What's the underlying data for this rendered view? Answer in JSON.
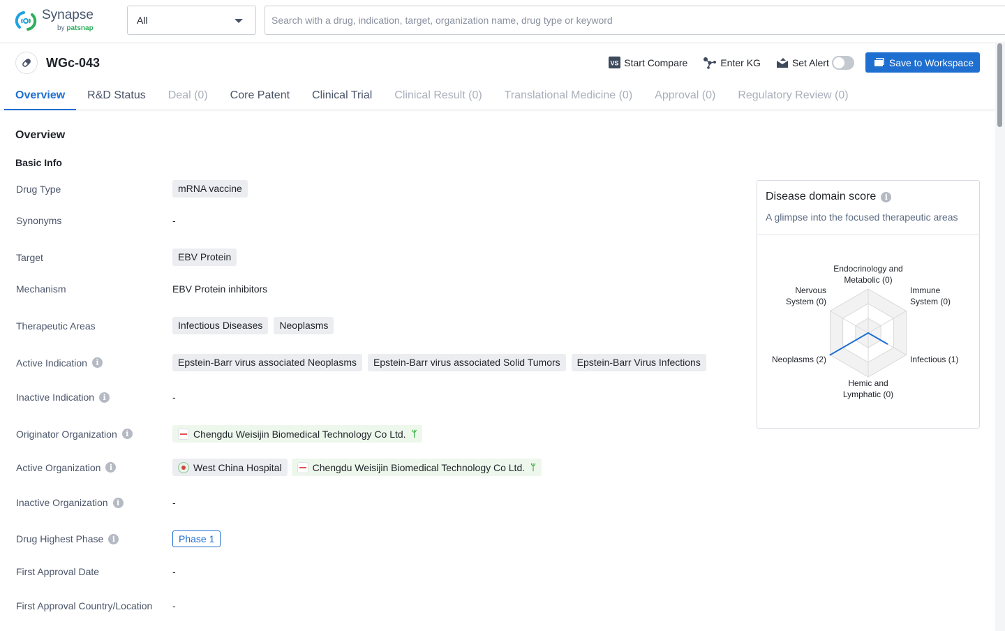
{
  "app": {
    "logo_name": "Synapse",
    "logo_by": "by",
    "logo_brand": "patsnap"
  },
  "search": {
    "scope_selected": "All",
    "placeholder": "Search with a drug, indication, target, organization name, drug type or keyword",
    "value": ""
  },
  "drug": {
    "name": "WGc-043",
    "icon": "pill-icon"
  },
  "actions": {
    "compare": "Start Compare",
    "kg": "Enter KG",
    "alert": "Set Alert",
    "alert_enabled": false,
    "save": "Save to Workspace"
  },
  "tabs": [
    {
      "label": "Overview",
      "state": "active"
    },
    {
      "label": "R&D Status",
      "state": "normal"
    },
    {
      "label": "Deal (0)",
      "state": "disabled"
    },
    {
      "label": "Core Patent",
      "state": "normal"
    },
    {
      "label": "Clinical Trial",
      "state": "normal"
    },
    {
      "label": "Clinical Result (0)",
      "state": "disabled"
    },
    {
      "label": "Translational Medicine (0)",
      "state": "disabled"
    },
    {
      "label": "Approval (0)",
      "state": "disabled"
    },
    {
      "label": "Regulatory Review (0)",
      "state": "disabled"
    }
  ],
  "overview": {
    "title": "Overview",
    "basic_info": "Basic Info",
    "fields": {
      "drug_type": {
        "label": "Drug Type",
        "tags": [
          "mRNA vaccine"
        ]
      },
      "synonyms": {
        "label": "Synonyms",
        "value": "-"
      },
      "target": {
        "label": "Target",
        "tags": [
          "EBV Protein"
        ]
      },
      "mechanism": {
        "label": "Mechanism",
        "value": "EBV Protein inhibitors"
      },
      "therapeutic_areas": {
        "label": "Therapeutic Areas",
        "tags": [
          "Infectious Diseases",
          "Neoplasms"
        ]
      },
      "active_indication": {
        "label": "Active Indication",
        "tags": [
          "Epstein-Barr virus associated Neoplasms",
          "Epstein-Barr virus associated Solid Tumors",
          "Epstein-Barr Virus Infections"
        ]
      },
      "inactive_indication": {
        "label": "Inactive Indication",
        "value": "-"
      },
      "originator_org": {
        "label": "Originator Organization",
        "orgs": [
          "Chengdu Weisijin Biomedical Technology Co Ltd."
        ]
      },
      "active_org": {
        "label": "Active Organization",
        "orgs": [
          "West China Hospital",
          "Chengdu Weisijin Biomedical Technology Co Ltd."
        ]
      },
      "inactive_org": {
        "label": "Inactive Organization",
        "value": "-"
      },
      "highest_phase": {
        "label": "Drug Highest Phase",
        "value": "Phase 1"
      },
      "first_approval_date": {
        "label": "First Approval Date",
        "value": "-"
      },
      "first_approval_country": {
        "label": "First Approval Country/Location",
        "value": "-"
      }
    }
  },
  "disease_card": {
    "title": "Disease domain score",
    "subtitle": "A glimpse into the focused therapeutic areas",
    "accent": "#1f6fd1"
  },
  "chart_data": {
    "type": "radar",
    "title": "Disease domain score",
    "axes": [
      {
        "name": "Endocrinology and Metabolic",
        "line1": "Endocrinology and",
        "line2": "Metabolic (0)",
        "value": 0
      },
      {
        "name": "Immune System",
        "line1": "Immune",
        "line2": "System (0)",
        "value": 0
      },
      {
        "name": "Infectious",
        "line1": "Infectious (1)",
        "line2": "",
        "value": 1
      },
      {
        "name": "Hemic and Lymphatic",
        "line1": "Hemic and",
        "line2": "Lymphatic (0)",
        "value": 0
      },
      {
        "name": "Neoplasms",
        "line1": "Neoplasms (2)",
        "line2": "",
        "value": 2
      },
      {
        "name": "Nervous System",
        "line1": "Nervous",
        "line2": "System (0)",
        "value": 0
      }
    ],
    "max": 2,
    "levels": 3
  }
}
